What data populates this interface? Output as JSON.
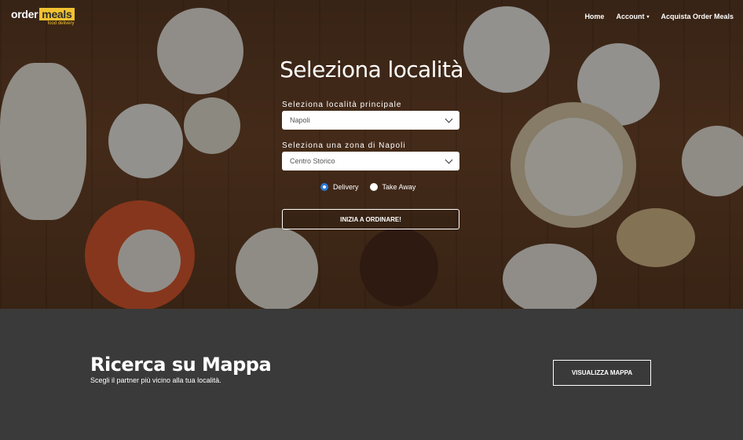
{
  "brand": {
    "word1": "order",
    "word2": "meals",
    "tagline": "food delivery",
    "accent": "#f2c230"
  },
  "nav": {
    "home": "Home",
    "account": "Account",
    "account_icon": "chevron-down-icon",
    "buy": "Acquista Order Meals"
  },
  "hero": {
    "title": "Seleziona località",
    "city_label": "Seleziona località principale",
    "city_value": "Napoli",
    "zone_label": "Seleziona una zona di Napoli",
    "zone_value": "Centro Storico",
    "radio_delivery": "Delivery",
    "radio_takeaway": "Take Away",
    "selected_mode": "Delivery",
    "cta": "INIZIA A ORDINARE!"
  },
  "map": {
    "title": "Ricerca su Mappa",
    "subtitle": "Scegli il partner più vicino alla tua località.",
    "button": "VISUALIZZA MAPPA"
  },
  "colors": {
    "radio_checked": "#2d79d6",
    "map_bg": "#3a3a3a"
  }
}
